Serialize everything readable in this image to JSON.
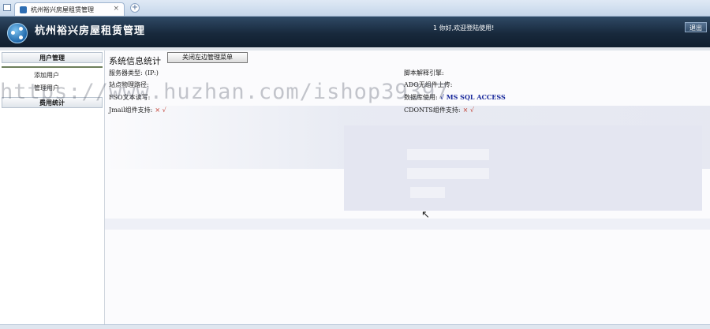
{
  "browser": {
    "tab_title": "杭州裕兴房屋租赁管理",
    "tab_close": "×",
    "new_tab": "+"
  },
  "header": {
    "app_title": "杭州裕兴房屋租赁管理",
    "welcome": "1 你好,欢迎登陆使用!",
    "logout_label": "退出"
  },
  "sidebar": {
    "section1": "用户管理",
    "items": [
      {
        "label": "添加用户"
      },
      {
        "label": "管理用户"
      }
    ],
    "section2": "费用统计"
  },
  "main": {
    "title": "系统信息统计",
    "toggle_menu_label": "关闭左边管理菜单",
    "left_rows": [
      {
        "label": "服务器类型:",
        "value": "(IP:)"
      },
      {
        "label": "站点物理路径:",
        "value": ""
      },
      {
        "label": "FSO文本读写:",
        "value": ""
      },
      {
        "label": "Jmail组件支持:",
        "value": "× √"
      }
    ],
    "right_rows": [
      {
        "label": "脚本解释引擎:",
        "value": ""
      },
      {
        "label": "ADO无组件上传:",
        "value": ""
      },
      {
        "label": "数据库使用:",
        "value": "√ MS SQL ACCESS"
      },
      {
        "label": "CDONTS组件支持:",
        "value": "× √"
      }
    ]
  },
  "watermark": "https://www.huzhan.com/ishop39397"
}
